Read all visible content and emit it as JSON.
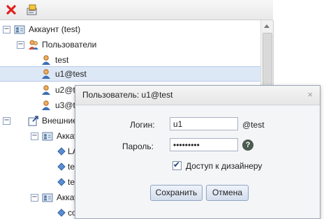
{
  "toolbar": {
    "delete_icon": "delete-x-icon",
    "config_icon": "config-icon"
  },
  "tree": {
    "account": "Аккаунт (test)",
    "users_folder": "Пользователи",
    "users": [
      "test",
      "u1@test",
      "u2@t",
      "u3@t"
    ],
    "external": "Внешние",
    "ext_account_1": "Аккау",
    "ext_items_1": [
      "LA",
      "te",
      "te"
    ],
    "ext_account_2": "Аккау",
    "ext_items_2": [
      "co"
    ]
  },
  "dialog": {
    "title": "Пользователь: u1@test",
    "close": "×",
    "login_label": "Логин:",
    "login_value": "u1",
    "domain_suffix": "@test",
    "password_label": "Пароль:",
    "password_value": "•••••••••",
    "help": "?",
    "designer_access_label": "Доступ к дизайнеру",
    "designer_access_checked": true,
    "save_button": "Сохранить",
    "cancel_button": "Отмена"
  },
  "colors": {
    "selected_row": "#dde8f6",
    "button_border": "#8ea3c3",
    "delete_red": "#e02020"
  }
}
